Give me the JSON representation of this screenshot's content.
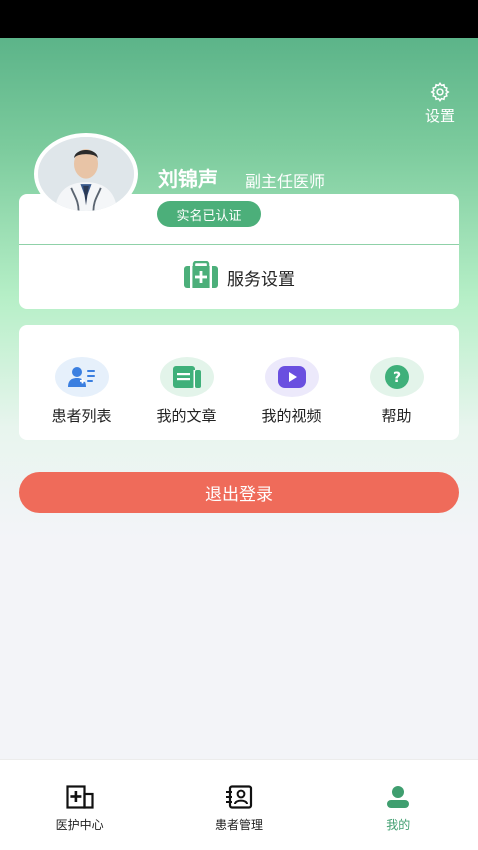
{
  "header": {
    "settings_label": "设置",
    "doctor_name": "刘锦声",
    "doctor_title": "副主任医师",
    "verified_badge": "实名已认证",
    "service_settings_label": "服务设置"
  },
  "menu": {
    "items": [
      {
        "label": "患者列表",
        "icon": "patient-list-icon"
      },
      {
        "label": "我的文章",
        "icon": "article-icon"
      },
      {
        "label": "我的视频",
        "icon": "video-icon"
      },
      {
        "label": "帮助",
        "icon": "help-icon"
      }
    ]
  },
  "logout_label": "退出登录",
  "tabbar": {
    "tabs": [
      {
        "label": "医护中心",
        "icon": "medical-center-icon",
        "active": false
      },
      {
        "label": "患者管理",
        "icon": "patient-management-icon",
        "active": false
      },
      {
        "label": "我的",
        "icon": "profile-icon",
        "active": true
      }
    ]
  },
  "colors": {
    "brand_green": "#4caf7a",
    "logout_red": "#ef6b5a",
    "active_tab": "#3f9e6f"
  }
}
